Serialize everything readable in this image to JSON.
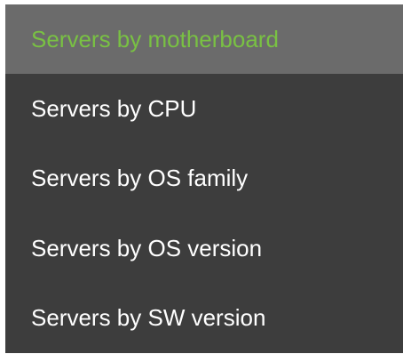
{
  "menu": {
    "active_color": "#79c143",
    "items": [
      {
        "label": "Servers by motherboard",
        "active": true
      },
      {
        "label": "Servers by CPU",
        "active": false
      },
      {
        "label": "Servers by OS family",
        "active": false
      },
      {
        "label": "Servers by OS version",
        "active": false
      },
      {
        "label": "Servers by SW version",
        "active": false
      }
    ]
  }
}
